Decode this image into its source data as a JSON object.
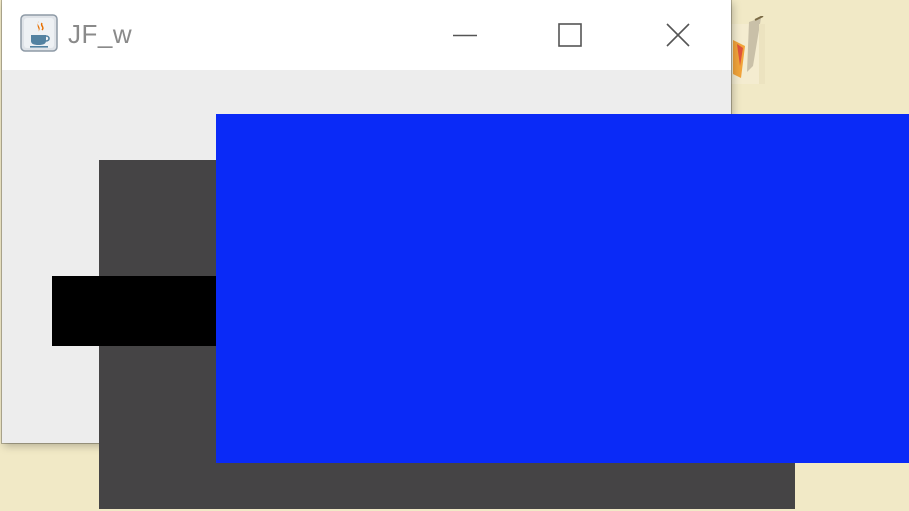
{
  "window": {
    "title": "JF_w",
    "app_icon": "java-cup-icon",
    "controls": {
      "minimize_icon": "minimize-icon",
      "maximize_icon": "maximize-icon",
      "close_icon": "close-icon"
    }
  },
  "desktop": {
    "background_color": "#f1e9c6",
    "partial_icon": "paint-palette-icon"
  },
  "canvas": {
    "dark_rect_color": "#454445",
    "black_rect_color": "#000000",
    "blue_rect_color": "#0a2af7"
  }
}
